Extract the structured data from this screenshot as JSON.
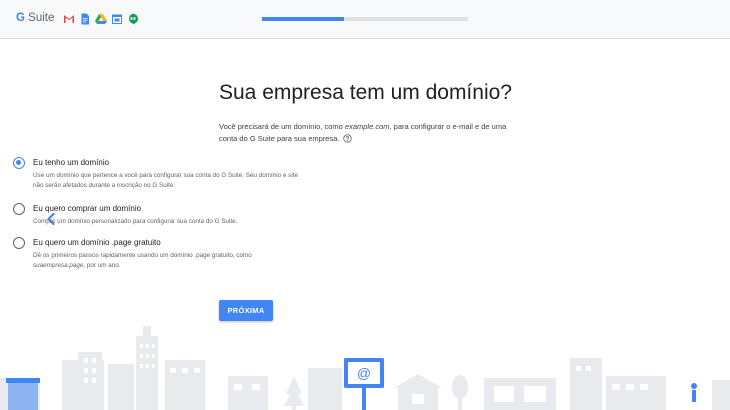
{
  "header": {
    "logo_g": "G",
    "logo_suite": " Suite",
    "apps": [
      "gmail-icon",
      "docs-icon",
      "drive-icon",
      "calendar-icon",
      "hangouts-icon"
    ],
    "progress": 0.4
  },
  "main": {
    "title": "Sua empresa tem um domínio?",
    "intro_prefix": "Você precisará de um domínio, como ",
    "intro_example": "example.com",
    "intro_suffix": ", para configurar o e-mail e de uma conta do G Suite para sua empresa.",
    "options": [
      {
        "label": "Eu tenho um domínio",
        "desc": "Use um domínio que pertence a você para configurar sua conta do G Suite. Seu domínio e site não serão afetados durante a inscrição no G Suite.",
        "selected": true
      },
      {
        "label": "Eu quero comprar um domínio",
        "desc": "Compre um domínio personalizado para configurar sua conta do G Suite.",
        "selected": false
      },
      {
        "label": "Eu quero um domínio .page gratuito",
        "desc_prefix": "Dê os primeiros passos rapidamente usando um domínio .page gratuito, como ",
        "desc_example": "suaempresa.page",
        "desc_suffix": ", por um ano.",
        "selected": false
      }
    ],
    "next_label": "PRÓXIMA"
  },
  "billboard_symbol": "@",
  "colors": {
    "accent": "#4285f4",
    "city": "#e8eaed",
    "city_blue": "#4285f4"
  }
}
